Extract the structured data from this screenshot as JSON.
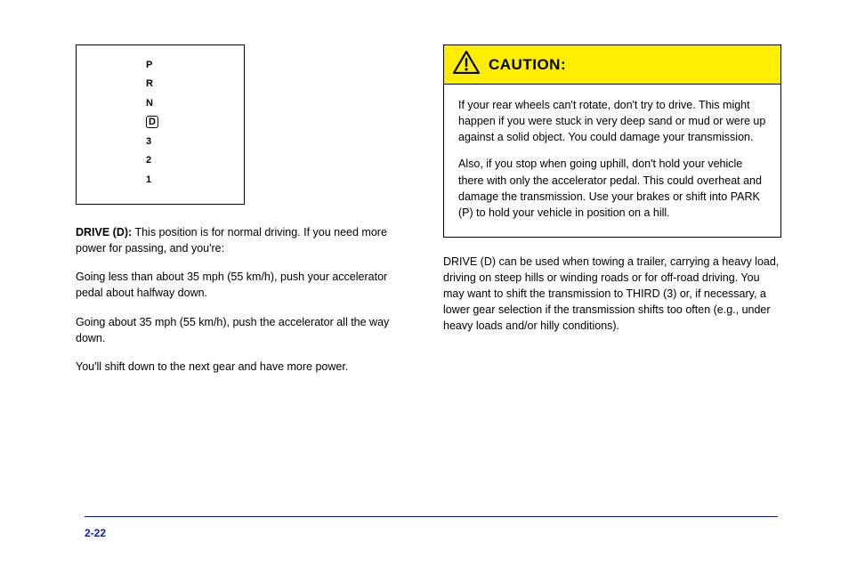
{
  "gear": {
    "positions": [
      "P",
      "R",
      "N",
      "D",
      "3",
      "2",
      "1"
    ],
    "selected_index": 3
  },
  "left": {
    "d_label": "DRIVE (D):",
    "d_text": " This position is for normal driving. If you need more power for passing, and you're:",
    "bullet1": "Going less than about 35 mph (55 km/h), push your accelerator pedal about halfway down.",
    "bullet2": "Going about 35 mph (55 km/h), push the accelerator all the way down.",
    "closing": "You'll shift down to the next gear and have more power."
  },
  "caution": {
    "title": "CAUTION:",
    "p1": "If your rear wheels can't rotate, don't try to drive. This might happen if you were stuck in very deep sand or mud or were up against a solid object. You could damage your transmission.",
    "p2": "Also, if you stop when going uphill, don't hold your vehicle there with only the accelerator pedal. This could overheat and damage the transmission. Use your brakes or shift into PARK (P) to hold your vehicle in position on a hill."
  },
  "right_below": "DRIVE (D) can be used when towing a trailer, carrying a heavy load, driving on steep hills or winding roads or for off-road driving. You may want to shift the transmission to THIRD (3) or, if necessary, a lower gear selection if the transmission shifts too often (e.g., under heavy loads and/or hilly conditions).",
  "page_number": "2-22"
}
